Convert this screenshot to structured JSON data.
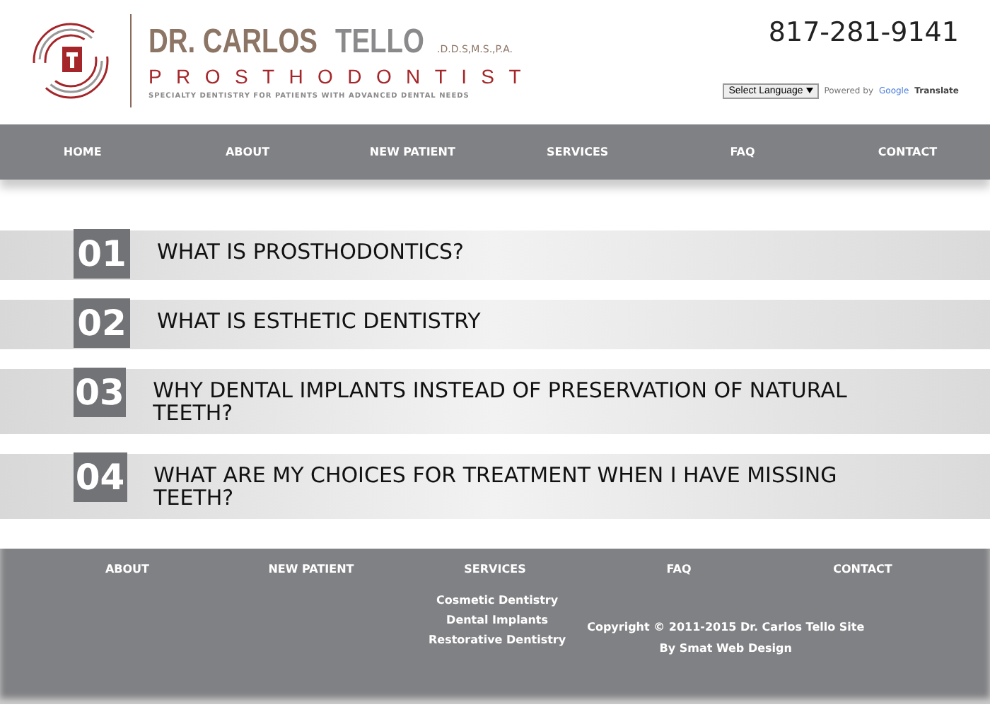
{
  "header": {
    "name_first": "DR. CARLOS",
    "name_last": "TELLO",
    "credentials": ".D.D.S,M.S.,P.A.",
    "title": "PROSTHODONTIST",
    "tagline": "SPECIALTY DENTISTRY FOR PATIENTS WITH ADVANCED DENTAL NEEDS",
    "phone": "817-281-9141",
    "language_select": "Select Language",
    "powered_by": "Powered by",
    "translate_brand": "Google",
    "translate_label": "Translate"
  },
  "nav": [
    "HOME",
    "ABOUT",
    "NEW PATIENT",
    "SERVICES",
    "FAQ",
    "CONTACT"
  ],
  "faq": [
    {
      "number": "01",
      "question": "WHAT IS PROSTHODONTICS?"
    },
    {
      "number": "02",
      "question": "WHAT IS ESTHETIC DENTISTRY"
    },
    {
      "number": "03",
      "question": "WHY DENTAL IMPLANTS INSTEAD OF PRESERVATION OF NATURAL TEETH?"
    },
    {
      "number": "04",
      "question": "WHAT ARE MY CHOICES FOR TREATMENT WHEN I HAVE MISSING TEETH?"
    }
  ],
  "footer": {
    "nav": [
      "ABOUT",
      "NEW PATIENT",
      "SERVICES",
      "FAQ",
      "CONTACT"
    ],
    "services": [
      "Cosmetic Dentistry",
      "Dental Implants",
      "Restorative Dentistry"
    ],
    "copyright": "Copyright © 2011-2015 Dr. Carlos Tello Site",
    "credit": "By Smat Web Design"
  }
}
